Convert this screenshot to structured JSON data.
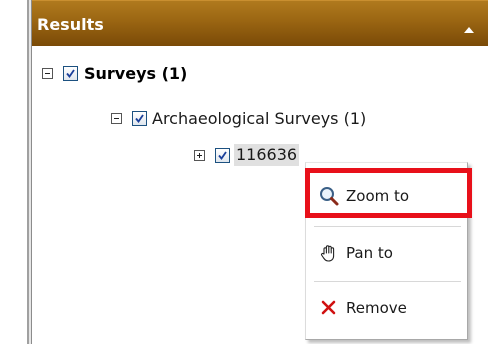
{
  "panel": {
    "title": "Results",
    "collapse_icon": "triangle-up-icon"
  },
  "tree": {
    "root": {
      "label": "Surveys (1)",
      "expanded": true,
      "checked": true
    },
    "child": {
      "label": "Archaeological Surveys (1)",
      "expanded": true,
      "checked": true
    },
    "leaf": {
      "label": "116636",
      "expanded": false,
      "checked": true,
      "selected": true
    }
  },
  "context_menu": {
    "items": [
      {
        "label": "Zoom to",
        "icon": "magnifier-icon",
        "highlighted": true
      },
      {
        "label": "Pan to",
        "icon": "hand-icon"
      },
      {
        "label": "Remove",
        "icon": "red-x-icon"
      }
    ]
  },
  "colors": {
    "header_top": "#b07a1e",
    "header_bottom": "#7a4a07",
    "highlight_border": "#e8101a",
    "remove_x": "#d01010",
    "checkbox_border": "#1c5180"
  }
}
